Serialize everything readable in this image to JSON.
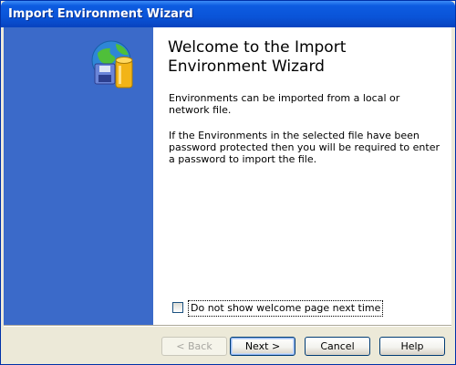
{
  "window": {
    "title": "Import Environment Wizard"
  },
  "content": {
    "heading": "Welcome to the Import Environment Wizard",
    "paragraph1": "Environments can be imported from a local or network file.",
    "paragraph2": "If the Environments in the selected file have been password protected then you will be required to enter a password to import the file."
  },
  "options": {
    "dont_show_label": "Do not show welcome page next time",
    "dont_show_checked": false
  },
  "buttons": {
    "back": "< Back",
    "next": "Next >",
    "cancel": "Cancel",
    "help": "Help"
  },
  "icons": {
    "wizard": "globe-database-floppy-icon"
  },
  "colors": {
    "title_bar": "#0a54d8",
    "side_panel": "#3b6ac9",
    "dialog_face": "#ece9d8",
    "content_background": "#ffffff"
  }
}
